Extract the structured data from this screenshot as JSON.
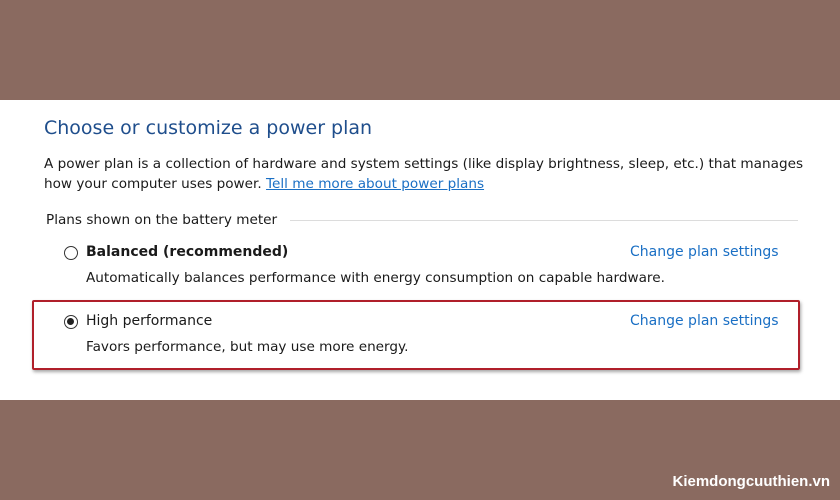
{
  "header": {
    "title": "Choose or customize a power plan",
    "description": "A power plan is a collection of hardware and system settings (like display brightness, sleep, etc.) that manages how your computer uses power.",
    "learn_more_link": "Tell me more about power plans"
  },
  "plans_group": {
    "label": "Plans shown on the battery meter",
    "plans": [
      {
        "name": "Balanced (recommended)",
        "description": "Automatically balances performance with energy consumption on capable hardware.",
        "link": "Change plan settings",
        "selected": false
      },
      {
        "name": "High performance",
        "description": "Favors performance, but may use more energy.",
        "link": "Change plan settings",
        "selected": true
      }
    ]
  },
  "watermark": "Kiemdongcuuthien.vn",
  "colors": {
    "background": "#8a6a60",
    "title": "#1f4e8c",
    "link": "#1a6fc4",
    "highlight_border": "#b01f2a"
  }
}
